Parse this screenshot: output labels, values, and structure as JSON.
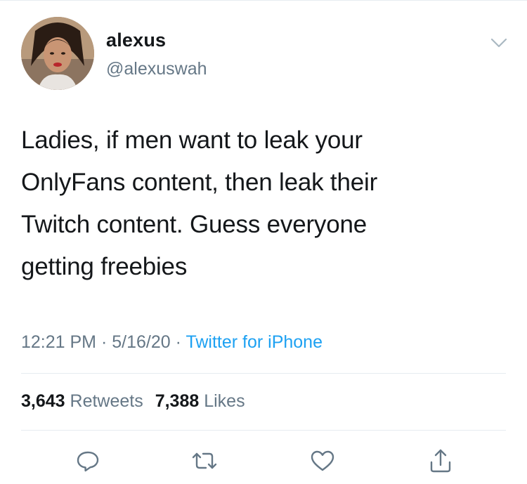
{
  "tweet": {
    "display_name": "alexus",
    "handle": "@alexuswah",
    "text_lines": [
      "Ladies, if men want to leak your",
      "OnlyFans content, then leak their",
      "Twitch content. Guess everyone",
      "getting freebies"
    ],
    "time": "12:21 PM",
    "date": "5/16/20",
    "separator": "·",
    "source": "Twitter for iPhone",
    "retweets_count": "3,643",
    "retweets_label": "Retweets",
    "likes_count": "7,388",
    "likes_label": "Likes"
  },
  "icons": {
    "menu": "chevron-down-icon",
    "reply": "reply-icon",
    "retweet": "retweet-icon",
    "like": "heart-icon",
    "share": "share-icon"
  },
  "colors": {
    "text": "#14171a",
    "secondary": "#657786",
    "link": "#1da1f2",
    "divider": "#e6ecf0"
  }
}
